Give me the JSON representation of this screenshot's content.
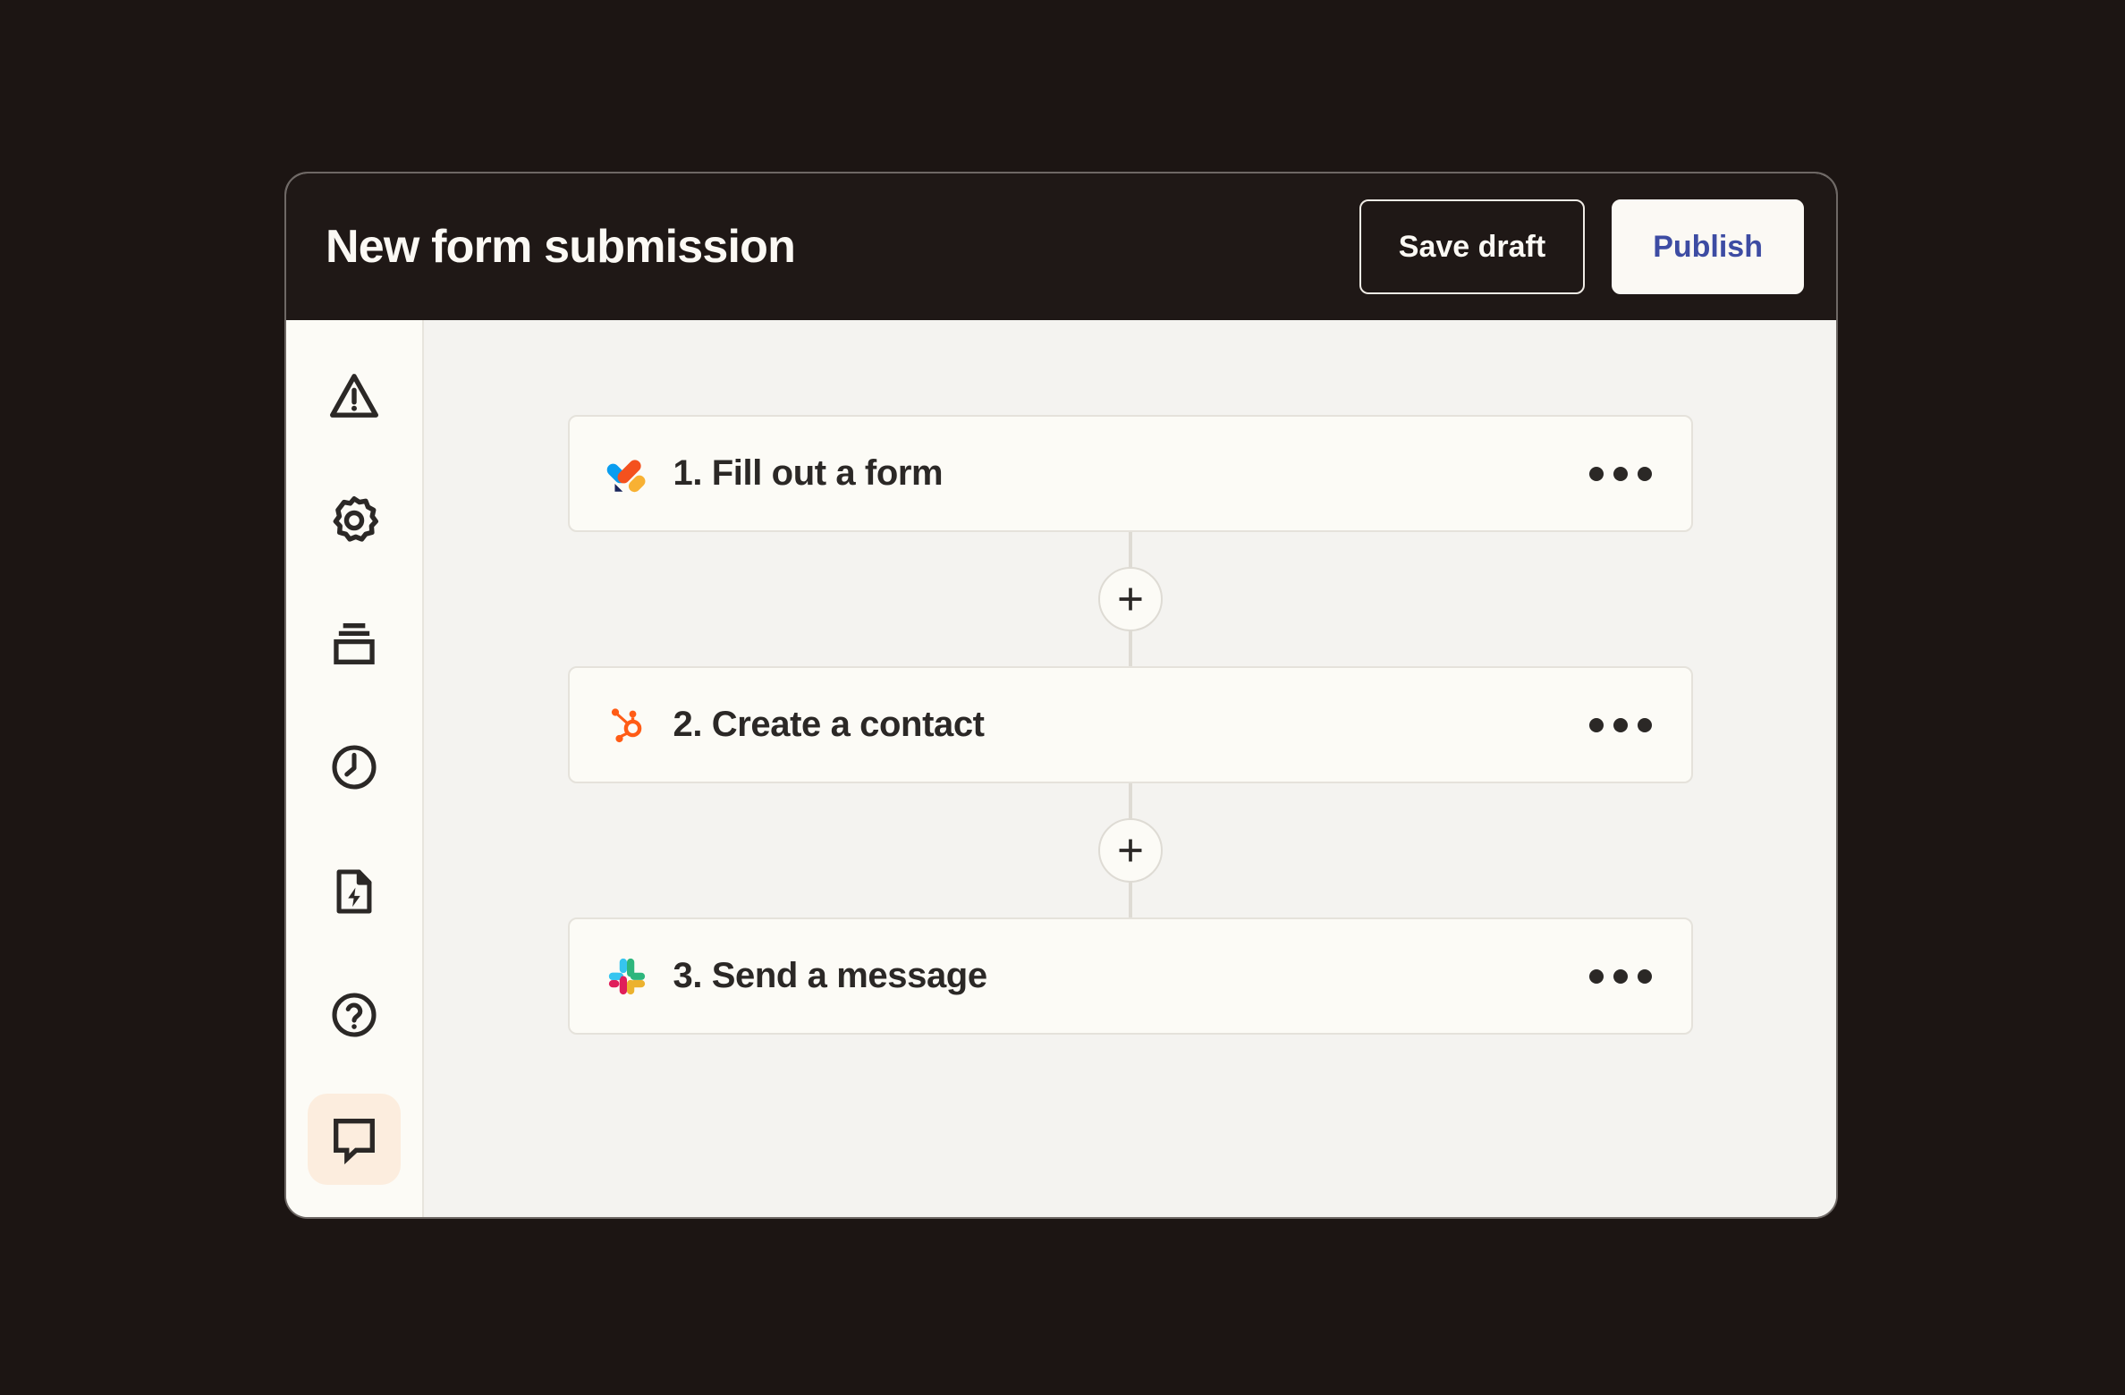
{
  "window": {
    "header": {
      "title": "New form submission",
      "buttons": [
        {
          "name": "save-draft-button",
          "label": "Save draft"
        },
        {
          "name": "publish-button",
          "label": "Publish"
        }
      ]
    },
    "sidebar": {
      "items": [
        {
          "icon": "warning-triangle-icon",
          "active": false
        },
        {
          "icon": "gear-icon",
          "active": false
        },
        {
          "icon": "stack-icon",
          "active": false
        },
        {
          "icon": "clock-icon",
          "active": false
        },
        {
          "icon": "document-lightning-icon",
          "active": false
        },
        {
          "icon": "help-circle-icon",
          "active": false
        },
        {
          "icon": "feedback-chat-icon",
          "active": true
        }
      ]
    },
    "canvas": {
      "steps": [
        {
          "label": "1. Fill out a form",
          "app_icon": "jotform-icon",
          "menu": "more-options-icon"
        },
        {
          "label": "2. Create a contact",
          "app_icon": "hubspot-icon",
          "menu": "more-options-icon"
        },
        {
          "label": "3. Send a message",
          "app_icon": "slack-icon",
          "menu": "more-options-icon"
        }
      ],
      "connectors": [
        {
          "icon": "plus-icon"
        },
        {
          "icon": "plus-icon"
        }
      ]
    }
  },
  "colors": {
    "page_background": "#1C1513",
    "header_background": "#1F1816",
    "sidebar_background": "#FCFBF6",
    "canvas_background": "#F4F3F0",
    "card_background": "#FCFBF6",
    "card_border": "#E5E2DB",
    "publish_text": "#3D4CA3",
    "active_item_background": "#FCEDDE",
    "text_dark": "#2B2826",
    "text_light": "#FBF9F4"
  }
}
